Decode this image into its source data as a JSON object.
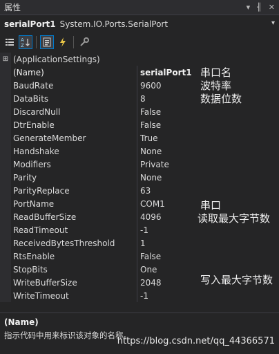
{
  "window": {
    "title": "属性",
    "pin_glyph": "▾ ╢ ✕"
  },
  "object_selector": {
    "name": "serialPort1",
    "type": "System.IO.Ports.SerialPort"
  },
  "toolbar": {
    "categorized_icon": "categorized-icon",
    "alphabetical_icon": "alphabetical-icon",
    "properties_icon": "properties-icon",
    "events_icon": "events-icon",
    "property_pages_icon": "property-pages-icon"
  },
  "grid": {
    "category": "(ApplicationSettings)",
    "rows": [
      {
        "name": "(Name)",
        "value": "serialPort1"
      },
      {
        "name": "BaudRate",
        "value": "9600"
      },
      {
        "name": "DataBits",
        "value": "8"
      },
      {
        "name": "DiscardNull",
        "value": "False"
      },
      {
        "name": "DtrEnable",
        "value": "False"
      },
      {
        "name": "GenerateMember",
        "value": "True"
      },
      {
        "name": "Handshake",
        "value": "None"
      },
      {
        "name": "Modifiers",
        "value": "Private"
      },
      {
        "name": "Parity",
        "value": "None"
      },
      {
        "name": "ParityReplace",
        "value": "63"
      },
      {
        "name": "PortName",
        "value": "COM1"
      },
      {
        "name": "ReadBufferSize",
        "value": "4096"
      },
      {
        "name": "ReadTimeout",
        "value": "-1"
      },
      {
        "name": "ReceivedBytesThreshold",
        "value": "1"
      },
      {
        "name": "RtsEnable",
        "value": "False"
      },
      {
        "name": "StopBits",
        "value": "One"
      },
      {
        "name": "WriteBufferSize",
        "value": "2048"
      },
      {
        "name": "WriteTimeout",
        "value": "-1"
      }
    ]
  },
  "annotations": {
    "name": "串口名",
    "baudrate": "波特率",
    "databits": "数据位数",
    "portname": "串口",
    "readbuffer": "读取最大字节数",
    "writebuffer": "写入最大字节数"
  },
  "description": {
    "title": "(Name)",
    "text": "指示代码中用来标识该对象的名称。"
  },
  "watermark": "https://blog.csdn.net/qq_44366571"
}
